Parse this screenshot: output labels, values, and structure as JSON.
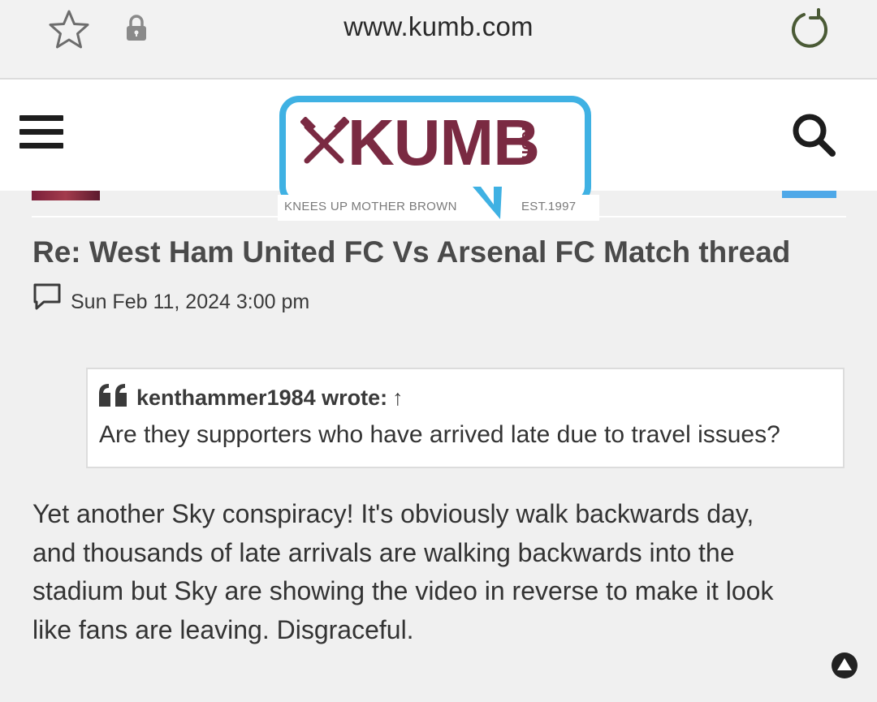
{
  "browser": {
    "url": "www.kumb.com"
  },
  "header": {
    "logo_text": "KUMB",
    "logo_com": ".com",
    "logo_tagline_left": "KNEES UP MOTHER BROWN",
    "logo_tagline_right": "EST.1997",
    "colors": {
      "logo_blue": "#3fb1e3",
      "logo_claret": "#7a2a42"
    }
  },
  "post": {
    "title": "Re: West Ham United FC Vs Arsenal FC Match thread",
    "date": "Sun Feb 11, 2024 3:00 pm",
    "quote": {
      "author": "kenthammer1984 wrote:",
      "arrow": "↑",
      "text": "Are they supporters who have arrived late due to travel issues?"
    },
    "body_lines": [
      "Yet another Sky conspiracy! It's obviously walk backwards day,",
      "and thousands of late arrivals are walking backwards into the",
      "stadium but Sky are showing the video in reverse to make it look",
      "like fans are leaving. Disgraceful."
    ]
  }
}
